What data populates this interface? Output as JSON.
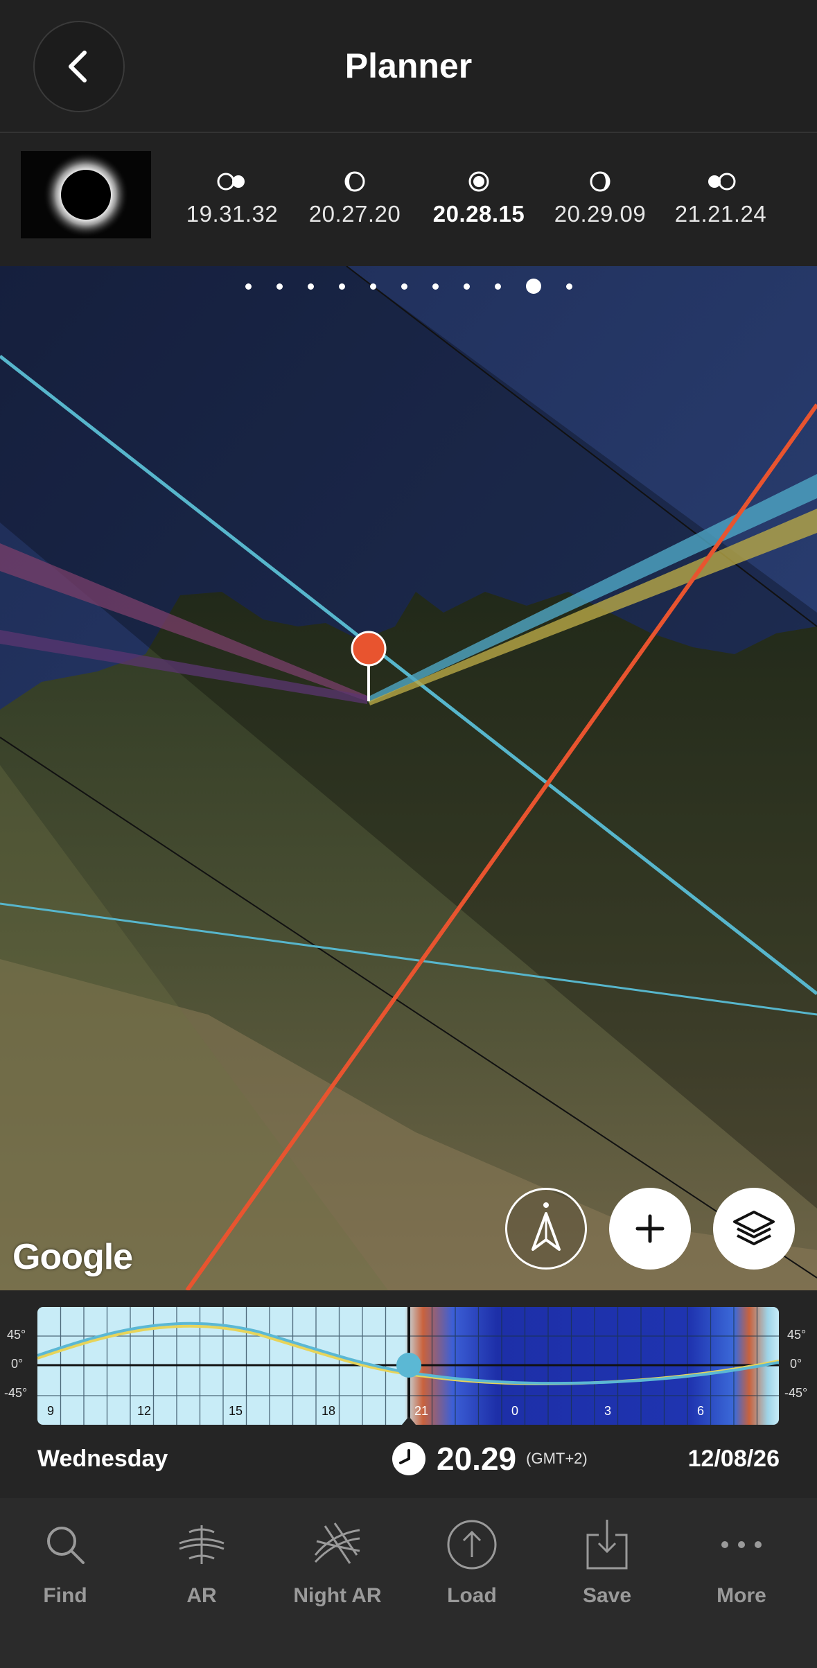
{
  "header": {
    "title": "Planner",
    "back_icon": "chevron-left-icon"
  },
  "phases": [
    {
      "time": "19.31.32",
      "icon": "first-contact-icon"
    },
    {
      "time": "20.27.20",
      "icon": "second-contact-icon"
    },
    {
      "time": "20.28.15",
      "icon": "maximum-eclipse-icon",
      "active": true
    },
    {
      "time": "20.29.09",
      "icon": "third-contact-icon"
    },
    {
      "time": "21.21.24",
      "icon": "fourth-contact-icon"
    }
  ],
  "pager": {
    "count": 11,
    "active_index": 9
  },
  "map": {
    "attribution": "Google",
    "pin_color": "#e8542f"
  },
  "timeline": {
    "y_labels": [
      "45°",
      "0°",
      "-45°"
    ],
    "x_labels": [
      "9",
      "12",
      "15",
      "18",
      "21",
      "0",
      "3",
      "6"
    ]
  },
  "datetime": {
    "weekday": "Wednesday",
    "time": "20.29",
    "timezone": "(GMT+2)",
    "date": "12/08/26"
  },
  "tabs": [
    {
      "label": "Find",
      "icon": "search-icon"
    },
    {
      "label": "AR",
      "icon": "ar-icon"
    },
    {
      "label": "Night AR",
      "icon": "night-ar-icon"
    },
    {
      "label": "Load",
      "icon": "upload-icon"
    },
    {
      "label": "Save",
      "icon": "download-icon"
    },
    {
      "label": "More",
      "icon": "more-icon"
    }
  ],
  "colors": {
    "sun": "#f2c94c",
    "moon": "#5bb8d4",
    "sunrise_line": "#e8542f",
    "background": "#222222"
  }
}
